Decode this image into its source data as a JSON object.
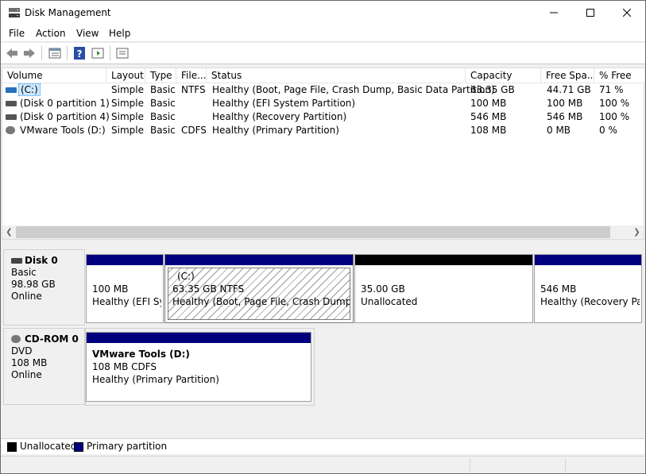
{
  "window": {
    "title": "Disk Management"
  },
  "menu": [
    "File",
    "Action",
    "View",
    "Help"
  ],
  "list": {
    "columns": [
      "Volume",
      "Layout",
      "Type",
      "File...",
      "Status",
      "Capacity",
      "Free Spa...",
      "% Free"
    ],
    "rows": [
      {
        "volume": "(C:)",
        "layout": "Simple",
        "type": "Basic",
        "fs": "NTFS",
        "status": "Healthy (Boot, Page File, Crash Dump, Basic Data Partition)",
        "capacity": "63.35 GB",
        "free": "44.71 GB",
        "pct": "71 %"
      },
      {
        "volume": "(Disk 0 partition 1)",
        "layout": "Simple",
        "type": "Basic",
        "fs": "",
        "status": "Healthy (EFI System Partition)",
        "capacity": "100 MB",
        "free": "100 MB",
        "pct": "100 %"
      },
      {
        "volume": "(Disk 0 partition 4)",
        "layout": "Simple",
        "type": "Basic",
        "fs": "",
        "status": "Healthy (Recovery Partition)",
        "capacity": "546 MB",
        "free": "546 MB",
        "pct": "100 %"
      },
      {
        "volume": "VMware Tools (D:)",
        "layout": "Simple",
        "type": "Basic",
        "fs": "CDFS",
        "status": "Healthy (Primary Partition)",
        "capacity": "108 MB",
        "free": "0 MB",
        "pct": "0 %"
      }
    ]
  },
  "disks": [
    {
      "name": "Disk 0",
      "type": "Basic",
      "size": "98.98 GB",
      "state": "Online",
      "partitions": [
        {
          "title": "",
          "line1": "100 MB",
          "line2": "Healthy (EFI Sys"
        },
        {
          "title": "(C:)",
          "line1": "63.35 GB NTFS",
          "line2": "Healthy (Boot, Page File, Crash Dump, Bas"
        },
        {
          "title": "",
          "line1": "35.00 GB",
          "line2": "Unallocated"
        },
        {
          "title": "",
          "line1": "546 MB",
          "line2": "Healthy (Recovery Part"
        }
      ]
    },
    {
      "name": "CD-ROM 0",
      "type": "DVD",
      "size": "108 MB",
      "state": "Online",
      "partitions": [
        {
          "title": "VMware Tools  (D:)",
          "line1": "108 MB CDFS",
          "line2": "Healthy (Primary Partition)"
        }
      ]
    }
  ],
  "legend": [
    "Unallocated",
    "Primary partition"
  ],
  "colors": {
    "primary": "#00007f",
    "unallocated": "#000000"
  }
}
